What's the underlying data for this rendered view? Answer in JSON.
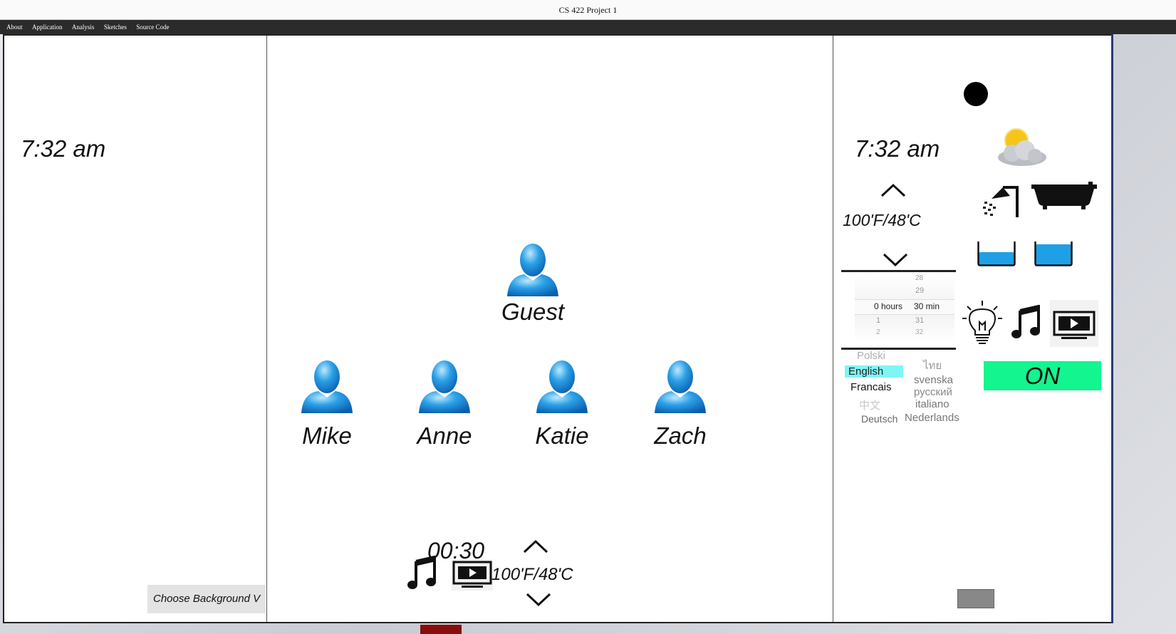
{
  "window": {
    "title": "CS 422 Project 1"
  },
  "menu": [
    "About",
    "Application",
    "Analysis",
    "Sketches",
    "Source Code"
  ],
  "left_panel": {
    "clock": "7:32 am",
    "choose_background": "Choose Background  V"
  },
  "center_panel": {
    "guest": {
      "name": "Guest"
    },
    "users": [
      {
        "name": "Mike"
      },
      {
        "name": "Anne"
      },
      {
        "name": "Katie"
      },
      {
        "name": "Zach"
      }
    ],
    "bottom": {
      "timer": "00:30",
      "temperature": "100'F/48'C",
      "icons": [
        "music-note-icon",
        "tv-icon",
        "chevron-up-icon",
        "chevron-down-icon"
      ]
    }
  },
  "right_panel": {
    "clock": "7:32 am",
    "temperature": "100'F/48'C",
    "timer_picker": {
      "rows": [
        {
          "hours": "",
          "minutes": "28"
        },
        {
          "hours": "",
          "minutes": "29"
        },
        {
          "hours": "0 hours",
          "minutes": "30 min"
        },
        {
          "hours": "1",
          "minutes": "31"
        },
        {
          "hours": "2",
          "minutes": "32"
        }
      ],
      "selected_row": 2
    },
    "languages": {
      "left": [
        "Polski",
        "English",
        "Francais",
        "中文",
        "Deutsch"
      ],
      "right": [
        "ไทย",
        "svenska",
        "русский",
        "italiano",
        "Nederlands"
      ],
      "selected": "English",
      "highlight_color": "#7ff6f6"
    },
    "on_button": "ON",
    "on_color": "#12f58f",
    "icons": [
      "weather-icon",
      "shower-icon",
      "bathtub-icon",
      "water-level-low-icon",
      "water-level-high-icon",
      "light-bulb-icon",
      "music-note-icon",
      "tv-icon",
      "status-dot-icon"
    ]
  }
}
